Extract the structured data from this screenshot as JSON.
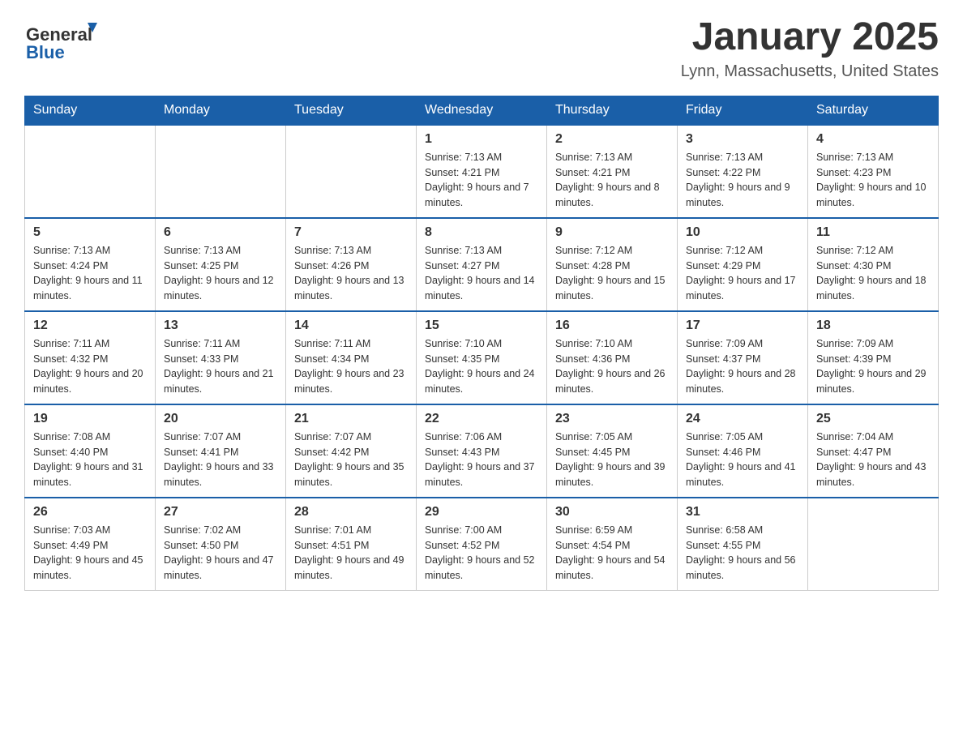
{
  "header": {
    "logo": {
      "general": "General",
      "blue": "Blue"
    },
    "title": "January 2025",
    "location": "Lynn, Massachusetts, United States"
  },
  "days_of_week": [
    "Sunday",
    "Monday",
    "Tuesday",
    "Wednesday",
    "Thursday",
    "Friday",
    "Saturday"
  ],
  "weeks": [
    [
      {
        "day": "",
        "info": ""
      },
      {
        "day": "",
        "info": ""
      },
      {
        "day": "",
        "info": ""
      },
      {
        "day": "1",
        "info": "Sunrise: 7:13 AM\nSunset: 4:21 PM\nDaylight: 9 hours and 7 minutes."
      },
      {
        "day": "2",
        "info": "Sunrise: 7:13 AM\nSunset: 4:21 PM\nDaylight: 9 hours and 8 minutes."
      },
      {
        "day": "3",
        "info": "Sunrise: 7:13 AM\nSunset: 4:22 PM\nDaylight: 9 hours and 9 minutes."
      },
      {
        "day": "4",
        "info": "Sunrise: 7:13 AM\nSunset: 4:23 PM\nDaylight: 9 hours and 10 minutes."
      }
    ],
    [
      {
        "day": "5",
        "info": "Sunrise: 7:13 AM\nSunset: 4:24 PM\nDaylight: 9 hours and 11 minutes."
      },
      {
        "day": "6",
        "info": "Sunrise: 7:13 AM\nSunset: 4:25 PM\nDaylight: 9 hours and 12 minutes."
      },
      {
        "day": "7",
        "info": "Sunrise: 7:13 AM\nSunset: 4:26 PM\nDaylight: 9 hours and 13 minutes."
      },
      {
        "day": "8",
        "info": "Sunrise: 7:13 AM\nSunset: 4:27 PM\nDaylight: 9 hours and 14 minutes."
      },
      {
        "day": "9",
        "info": "Sunrise: 7:12 AM\nSunset: 4:28 PM\nDaylight: 9 hours and 15 minutes."
      },
      {
        "day": "10",
        "info": "Sunrise: 7:12 AM\nSunset: 4:29 PM\nDaylight: 9 hours and 17 minutes."
      },
      {
        "day": "11",
        "info": "Sunrise: 7:12 AM\nSunset: 4:30 PM\nDaylight: 9 hours and 18 minutes."
      }
    ],
    [
      {
        "day": "12",
        "info": "Sunrise: 7:11 AM\nSunset: 4:32 PM\nDaylight: 9 hours and 20 minutes."
      },
      {
        "day": "13",
        "info": "Sunrise: 7:11 AM\nSunset: 4:33 PM\nDaylight: 9 hours and 21 minutes."
      },
      {
        "day": "14",
        "info": "Sunrise: 7:11 AM\nSunset: 4:34 PM\nDaylight: 9 hours and 23 minutes."
      },
      {
        "day": "15",
        "info": "Sunrise: 7:10 AM\nSunset: 4:35 PM\nDaylight: 9 hours and 24 minutes."
      },
      {
        "day": "16",
        "info": "Sunrise: 7:10 AM\nSunset: 4:36 PM\nDaylight: 9 hours and 26 minutes."
      },
      {
        "day": "17",
        "info": "Sunrise: 7:09 AM\nSunset: 4:37 PM\nDaylight: 9 hours and 28 minutes."
      },
      {
        "day": "18",
        "info": "Sunrise: 7:09 AM\nSunset: 4:39 PM\nDaylight: 9 hours and 29 minutes."
      }
    ],
    [
      {
        "day": "19",
        "info": "Sunrise: 7:08 AM\nSunset: 4:40 PM\nDaylight: 9 hours and 31 minutes."
      },
      {
        "day": "20",
        "info": "Sunrise: 7:07 AM\nSunset: 4:41 PM\nDaylight: 9 hours and 33 minutes."
      },
      {
        "day": "21",
        "info": "Sunrise: 7:07 AM\nSunset: 4:42 PM\nDaylight: 9 hours and 35 minutes."
      },
      {
        "day": "22",
        "info": "Sunrise: 7:06 AM\nSunset: 4:43 PM\nDaylight: 9 hours and 37 minutes."
      },
      {
        "day": "23",
        "info": "Sunrise: 7:05 AM\nSunset: 4:45 PM\nDaylight: 9 hours and 39 minutes."
      },
      {
        "day": "24",
        "info": "Sunrise: 7:05 AM\nSunset: 4:46 PM\nDaylight: 9 hours and 41 minutes."
      },
      {
        "day": "25",
        "info": "Sunrise: 7:04 AM\nSunset: 4:47 PM\nDaylight: 9 hours and 43 minutes."
      }
    ],
    [
      {
        "day": "26",
        "info": "Sunrise: 7:03 AM\nSunset: 4:49 PM\nDaylight: 9 hours and 45 minutes."
      },
      {
        "day": "27",
        "info": "Sunrise: 7:02 AM\nSunset: 4:50 PM\nDaylight: 9 hours and 47 minutes."
      },
      {
        "day": "28",
        "info": "Sunrise: 7:01 AM\nSunset: 4:51 PM\nDaylight: 9 hours and 49 minutes."
      },
      {
        "day": "29",
        "info": "Sunrise: 7:00 AM\nSunset: 4:52 PM\nDaylight: 9 hours and 52 minutes."
      },
      {
        "day": "30",
        "info": "Sunrise: 6:59 AM\nSunset: 4:54 PM\nDaylight: 9 hours and 54 minutes."
      },
      {
        "day": "31",
        "info": "Sunrise: 6:58 AM\nSunset: 4:55 PM\nDaylight: 9 hours and 56 minutes."
      },
      {
        "day": "",
        "info": ""
      }
    ]
  ]
}
